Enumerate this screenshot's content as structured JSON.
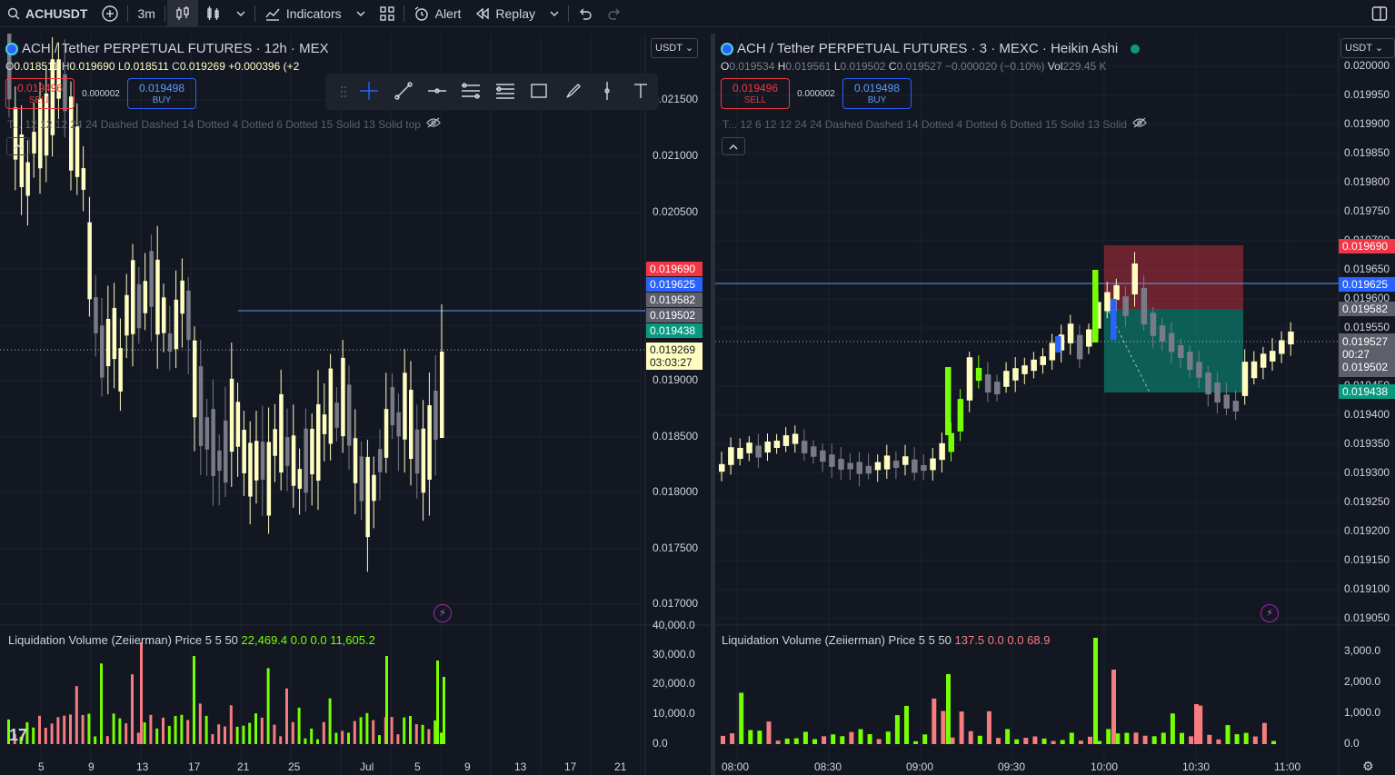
{
  "toolbar": {
    "symbol": "ACHUSDT",
    "interval": "3m",
    "indicators_label": "Indicators",
    "alert_label": "Alert",
    "replay_label": "Replay"
  },
  "left": {
    "legend_title": "ACH / Tether PERPETUAL FUTURES · 12h · MEX",
    "ohlc": {
      "o": "0.018511",
      "h": "0.019690",
      "l": "0.018511",
      "c": "0.019269",
      "chg": "+0.000396 (+2"
    },
    "sell_price": "0.019496",
    "sell_label": "SELL",
    "spread": "0.000002",
    "buy_price": "0.019498",
    "buy_label": "BUY",
    "ind_line": "T... 12 12 12 24 24 Dashed Dashed 14 Dotted 4 Dotted 6 Dotted 15 Solid 13 Solid top",
    "currency": "USDT",
    "subtitle": "Liquidation Volume (Zeiierman) Price 5 5 50",
    "sub_values": [
      "22,469.4",
      "0.0",
      "0.0",
      "11,605.2"
    ],
    "price_ticks": [
      "0.021500",
      "0.021000",
      "0.020500",
      "0.019000",
      "0.018500",
      "0.018000",
      "0.017500",
      "0.017000"
    ],
    "badges": [
      {
        "t": "0.019690",
        "bg": "#f23645",
        "fg": "#ffffff"
      },
      {
        "t": "0.019625",
        "bg": "#2962ff",
        "fg": "#ffffff"
      },
      {
        "t": "0.019582",
        "bg": "#5d606b",
        "fg": "#ffffff"
      },
      {
        "t": "0.019502",
        "bg": "#5d606b",
        "fg": "#ffffff"
      },
      {
        "t": "0.019438",
        "bg": "#089981",
        "fg": "#ffffff"
      }
    ],
    "last_price": "0.019269",
    "countdown": "03:03:27",
    "vol_ticks": [
      "40,000.0",
      "30,000.0",
      "20,000.0",
      "10,000.0",
      "0.0"
    ],
    "x_labels": [
      "5",
      "9",
      "13",
      "17",
      "21",
      "25",
      "Jul",
      "5",
      "9",
      "13",
      "17",
      "21"
    ]
  },
  "right": {
    "legend_title": "ACH / Tether PERPETUAL FUTURES · 3 · MEXC · Heikin Ashi",
    "ohlc": {
      "o": "0.019534",
      "h": "0.019561",
      "l": "0.019502",
      "c": "0.019527",
      "chg": "−0.000020 (−0.10%)",
      "vol": "229.45 K"
    },
    "sell_price": "0.019496",
    "sell_label": "SELL",
    "spread": "0.000002",
    "buy_price": "0.019498",
    "buy_label": "BUY",
    "ind_line": "T... 12 6 12 12 24 24 Dashed Dashed 14 Dotted 4 Dotted 6 Dotted 15 Solid 13 Solid",
    "currency": "USDT",
    "subtitle": "Liquidation Volume (Zeiierman) Price 5 5 50",
    "sub_values": [
      "137.5",
      "0.0",
      "0.0",
      "68.9"
    ],
    "price_ticks": [
      "0.020000",
      "0.019950",
      "0.019900",
      "0.019850",
      "0.019800",
      "0.019750",
      "0.019700",
      "0.019650",
      "0.019600",
      "0.019550",
      "0.019450",
      "0.019400",
      "0.019350",
      "0.019300",
      "0.019250",
      "0.019200",
      "0.019150",
      "0.019100",
      "0.019050"
    ],
    "badges": [
      {
        "t": "0.019690",
        "bg": "#f23645",
        "fg": "#ffffff"
      },
      {
        "t": "0.019625",
        "bg": "#2962ff",
        "fg": "#ffffff"
      },
      {
        "t": "0.019582",
        "bg": "#5d606b",
        "fg": "#ffffff"
      }
    ],
    "last_price": "0.019527",
    "countdown": "00:27",
    "badge_502": "0.019502",
    "badge_438": "0.019438",
    "vol_ticks": [
      "3,000.0",
      "2,000.0",
      "1,000.0",
      "0.0"
    ],
    "x_labels": [
      "08:00",
      "08:30",
      "09:00",
      "09:30",
      "10:00",
      "10:30",
      "11:00"
    ]
  },
  "colors": {
    "up": "#fffec0",
    "down": "#787b86",
    "liq_long": "#76ff03",
    "liq_short": "#f77c80",
    "accent": "#2962ff"
  }
}
